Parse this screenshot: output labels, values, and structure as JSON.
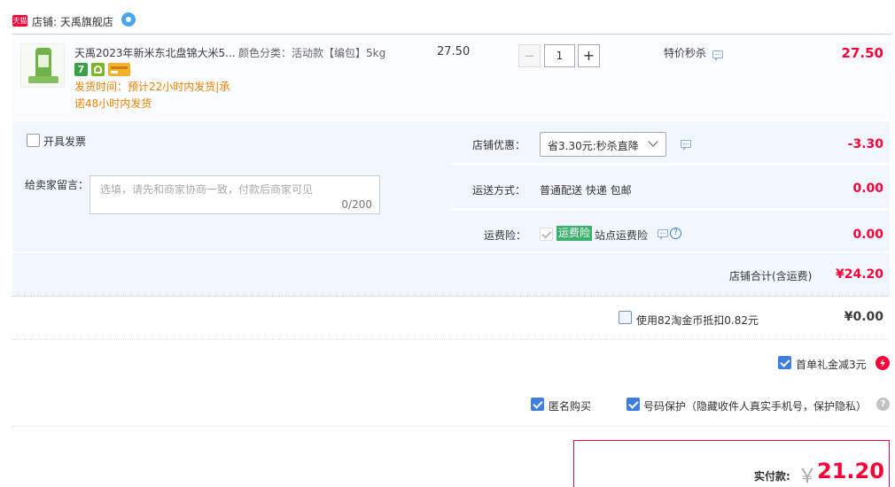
{
  "shop": {
    "tmall_badge": "天猫",
    "label": "店铺: 天禹旗舰店"
  },
  "item": {
    "title": "天禹2023年新米东北盘锦大米5...",
    "spec": "颜色分类：活动款【编包】5kg",
    "unit_price": "27.50",
    "quantity": "1",
    "minus_symbol": "−",
    "plus_symbol": "+",
    "promo": "特价秒杀",
    "subtotal": "27.50",
    "delivery_line1": "发货时间：预计22小时内发货|承",
    "delivery_line2": "诺48小时内发货",
    "tag_7": "7"
  },
  "options": {
    "invoice_label": "开具发票",
    "message_label": "给卖家留言：",
    "message_placeholder": "选填，请先和商家协商一致，付款后商家可见",
    "message_count": "0/200"
  },
  "discount": {
    "label": "店铺优惠：",
    "selected": "省3.30元:秒杀直降",
    "amount": "-3.30"
  },
  "shipping": {
    "label": "运送方式：",
    "method": "普通配送 快递 包邮",
    "amount": "0.00"
  },
  "insurance": {
    "label": "运费险：",
    "badge": "运费险",
    "text": "站点运费险",
    "help": "?",
    "amount": "0.00"
  },
  "store_total": {
    "label": "店铺合计(含运费)",
    "amount": "¥24.20"
  },
  "coins": {
    "label": "使用82淘金币抵扣0.82元",
    "amount": "¥0.00"
  },
  "gift": {
    "label": "首单礼金减3元"
  },
  "privacy": {
    "anonymous": "匿名购买",
    "phone": "号码保护（隐藏收件人真实手机号，保护隐私）",
    "help": "?"
  },
  "payable": {
    "label": "实付款:",
    "currency": "￥",
    "amount": "21.20"
  },
  "colors": {
    "accent_red": "#ff0036",
    "orange": "#f08200",
    "light_blue_bg": "#f2f7ff",
    "checkbox_blue": "#3d7fde",
    "insurance_green": "#3cb16b"
  }
}
